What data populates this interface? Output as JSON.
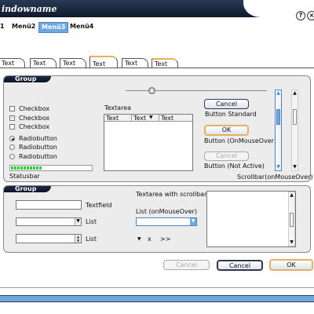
{
  "window": {
    "title": "indowname"
  },
  "title_buttons": {
    "help": "?",
    "close": "×"
  },
  "menu": {
    "items": [
      "1",
      "Menü2",
      "Menü3",
      "Menü4"
    ]
  },
  "tabs": [
    "Text",
    "Text",
    "Text",
    "Text",
    "Text",
    "Text"
  ],
  "group1": {
    "label": "Group",
    "checkboxes": [
      "Checkbox",
      "Checkbox",
      "Checkbox"
    ],
    "radios": [
      "Radiobutton",
      "Radiobutton",
      "Radiobutton"
    ],
    "statusbar_label": "Statusbar",
    "textarea_label": "Textarea",
    "table_headers": [
      "Text",
      "Text",
      "Text"
    ],
    "buttons": {
      "cancel": "Cancel",
      "ok": "OK",
      "cancel_disabled": "Cancel"
    },
    "button_captions": [
      "Button Standard",
      "Button (OnMouseOver)",
      "Button (Not Active)"
    ],
    "scrollbar_caption": "Scrollbar(onMouseOver)"
  },
  "group2": {
    "label": "Group",
    "textfield_label": "Textfield",
    "list_label": "List",
    "list2_label": "List",
    "textarea_scroll_label": "Textarea with scrollbar",
    "list_hover_label": "List (onMouseOver)",
    "nav": {
      "x": "x",
      "next": ">>"
    }
  },
  "footer": {
    "cancel_disabled": "Cancel",
    "cancel": "Cancel",
    "ok": "OK"
  }
}
